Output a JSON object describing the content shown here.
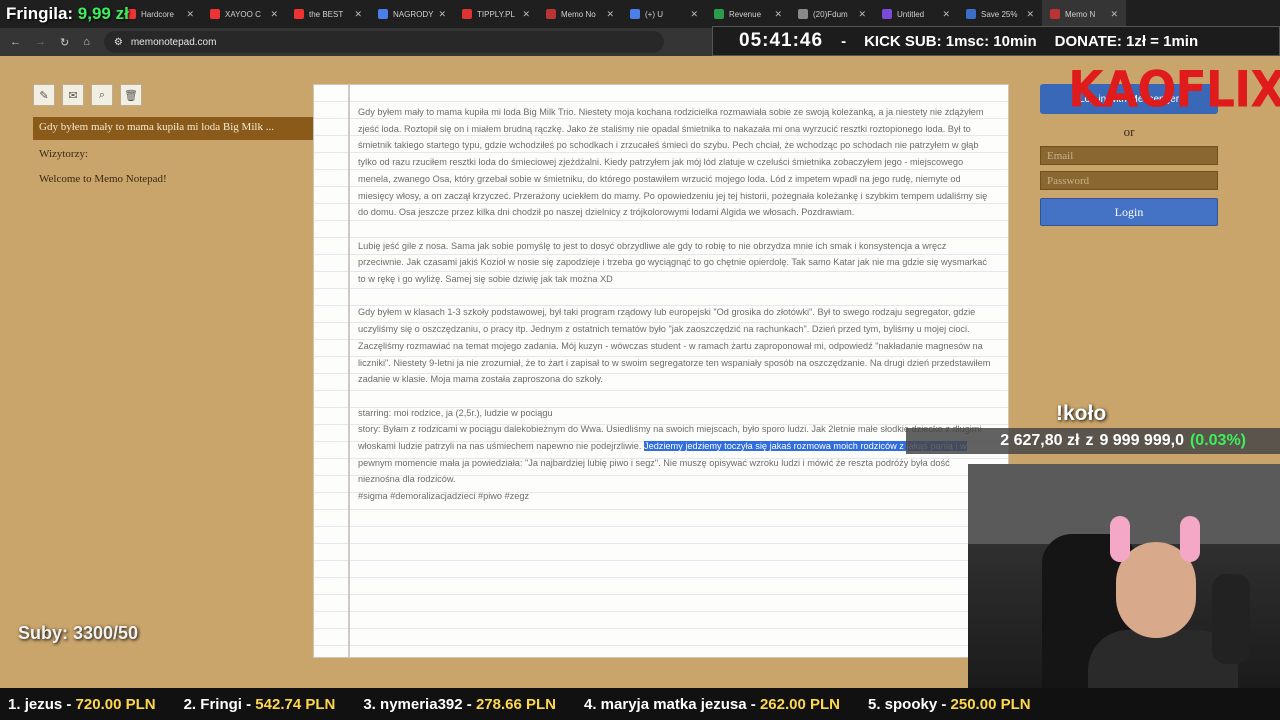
{
  "browser": {
    "tabs": [
      {
        "label": "Hardcore",
        "color": "#e33"
      },
      {
        "label": "XAYOO C",
        "color": "#e33"
      },
      {
        "label": "the BEST",
        "color": "#e33"
      },
      {
        "label": "NAGRODY",
        "color": "#4a7ee8"
      },
      {
        "label": "TIPPLY.PL",
        "color": "#d33"
      },
      {
        "label": "Memo No",
        "color": "#b33"
      },
      {
        "label": "(+) U",
        "color": "#4a7ee8"
      },
      {
        "label": "Revenue",
        "color": "#2a9d4a"
      },
      {
        "label": "(20)Fdum",
        "color": "#888"
      },
      {
        "label": "Untitled",
        "color": "#7a4ad8"
      },
      {
        "label": "Save 25%",
        "color": "#3a6ec8"
      },
      {
        "label": "Memo N",
        "color": "#b33"
      }
    ],
    "url": "memonotepad.com"
  },
  "overlay": {
    "fringila_label": "Fringila:",
    "fringila_amount": "9,99 zł",
    "clock": "05:41:46",
    "dash": "-",
    "kick_sub": "KICK SUB: 1msc: 10min",
    "donate": "DONATE: 1zł = 1min",
    "brand": "KAOFLIX",
    "kolo": "!koło",
    "balance": "2 627,80 zł",
    "balance_sep": "z",
    "target": "9 999 999,0",
    "percent": "(0.03%)",
    "suby": "Suby: 3300/50",
    "leaderboard": [
      {
        "rank": "1.",
        "name": "jezus",
        "amount": "720.00 PLN"
      },
      {
        "rank": "2.",
        "name": "Fringi",
        "amount": "542.74 PLN"
      },
      {
        "rank": "3.",
        "name": "nymeria392",
        "amount": "278.66 PLN"
      },
      {
        "rank": "4.",
        "name": "maryja matka jezusa",
        "amount": "262.00 PLN"
      },
      {
        "rank": "5.",
        "name": "spooky",
        "amount": "250.00 PLN"
      }
    ]
  },
  "sidebar": {
    "selected_note": "Gdy byłem mały to mama kupiła mi loda Big Milk ...",
    "visitors_label": "Wizytorzy:",
    "welcome": "Welcome to Memo Notepad!"
  },
  "note": {
    "p1": "Gdy byłem mały to mama kupiła mi loda Big Milk Trio. Niestety moja kochana rodzicielka rozmawiała sobie ze swoją koleżanką, a ja niestety nie zdążyłem zjeść loda. Roztopił się on i miałem brudną rączkę. Jako że staliśmy nie opadal śmietnika to nakazała mi ona wyrzucić resztki roztopionego loda. Był to śmietnik takiego startego typu, gdzie wchodziłeś po schodkach i zrzucałeś śmieci do szybu. Pech chciał, że wchodząc po schodach nie patrzyłem w głąb tylko od razu rzuciłem resztki loda do śmieciowej zjeżdżalni. Kiedy patrzyłem jak mój lód zlatuje w czeluści śmietnika zobaczyłem jego - miejscowego menela, zwanego Osa, który grzebał sobie w śmietniku, do którego postawiłem wrzucić mojego loda. Lód z impetem wpadł na jego rudę, niemyte od miesięcy włosy, a on zaczął krzyczeć. Przerażony uciekłem do mamy. Po opowiedzeniu jej tej historii, pożegnała koleżankę i szybkim tempem udaliśmy się do domu. Osa jeszcze przez kilka dni chodził po naszej dzielnicy z trójkolorowymi lodami Algida we włosach. Pozdrawiam.",
    "p2": "Lubię jeść gile z nosa. Sama jak sobie pomyślę to jest to dosyć obrzydliwe ale gdy to robię to nie obrzydza mnie ich smak i konsystencja a wręcz przeciwnie. Jak czasami jakiś Kozioł w nosie się zapodzieje i trzeba go wyciągnąć to go chętnie opierdolę. Tak samo Katar jak nie ma gdzie się wysmarkać to w rękę i go wyliżę. Samej się sobie dziwię jak tak można XD",
    "p3": "Gdy byłem w klasach 1-3 szkoły podstawowej, był taki program rządowy lub europejski \"Od grosika do złotówki\". Był to swego rodzaju segregator, gdzie uczyliśmy się o oszczędzaniu, o pracy itp. Jednym z ostatnich tematów było \"jak zaoszczędzić na rachunkach\". Dzień przed tym, byliśmy u mojej cioci. Zaczęliśmy rozmawiać na temat mojego zadania. Mój kuzyn - wówczas student - w ramach żartu zaproponował mi, odpowiedź \"nakładanie magnesów na liczniki\". Niestety 9-letni ja nie zrozumiał, że to żart i zapisał to w swoim segregatorze ten wspaniały sposób na oszczędzanie. Na drugi dzień przedstawiłem zadanie w klasie. Moja mama została zaproszona do szkoły.",
    "p4_line1": "starring: moi rodzice, ja (2,5r.), ludzie w pociągu",
    "p4_before": "story: Byłam z rodzicami w pociągu dalekobieżnym do Wwa. Usiedliśmy na swoich miejscach, było sporo ludzi. Jak 2letnie małe słodkie dziecko z długimi włoskami ludzie patrzyli na nas uśmiechem napewno nie podejrzliwie. ",
    "p4_selected": "Jedziemy jedziemy toczyła się jakaś rozmowa moich rodziców z jakąś panią i w",
    "p4_after": " pewnym momencie mała ja powiedziała: \"Ja najbardziej lubię piwo i segz\". Nie muszę opisywać wzroku ludzi i mówić że reszta podróży była dość nieznośna dla rodziców.",
    "p4_tags": "#sigma #demoralizacjadzieci #piwo #zegz"
  },
  "login": {
    "top_label": "Log in with Messenger",
    "or": "or",
    "email_placeholder": "Email",
    "password_placeholder": "Password",
    "button": "Login"
  }
}
